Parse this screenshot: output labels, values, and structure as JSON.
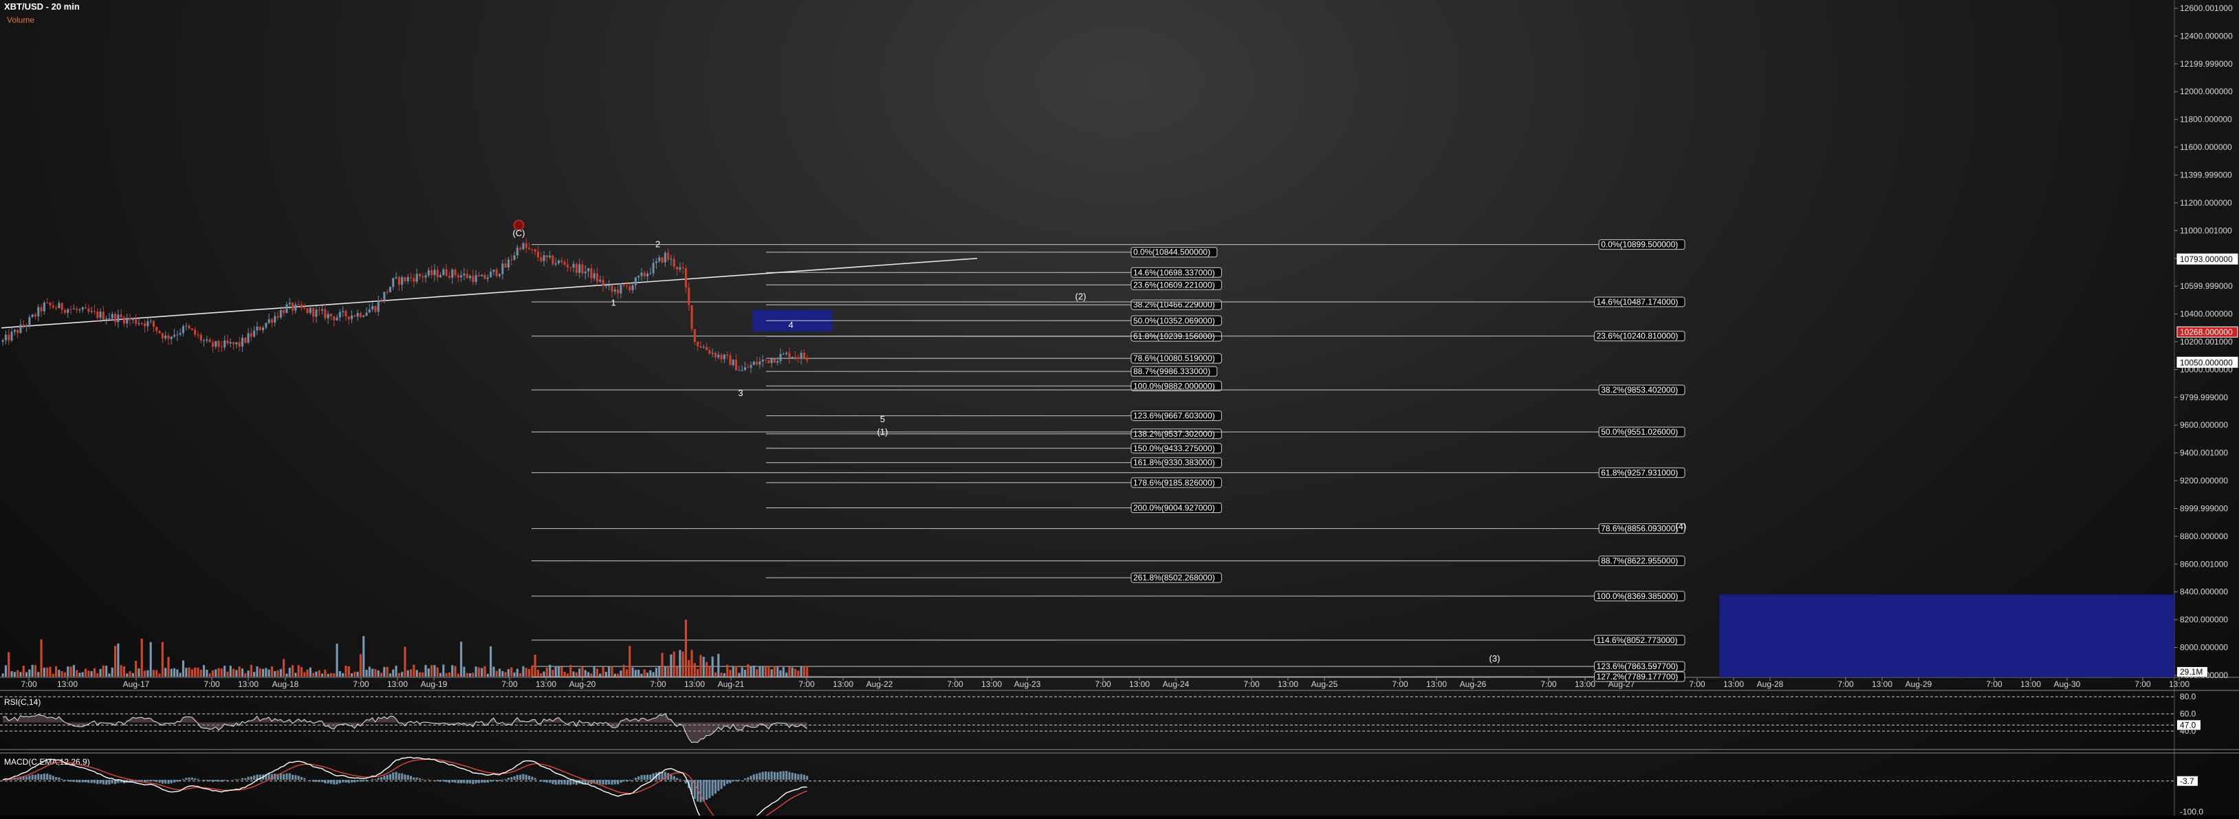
{
  "header": {
    "title": "XBT/USD - 20 min",
    "volume_label": "Volume"
  },
  "chart_data": [
    {
      "type": "line",
      "subtype": "candlestick",
      "title": "XBT/USD - 20 min",
      "price_axis": {
        "ticks": [
          "12600.001000",
          "12400.000000",
          "12199.999000",
          "12000.000000",
          "11800.000000",
          "11600.000000",
          "11399.999000",
          "11200.000000",
          "11000.001000",
          "10800.000000",
          "10599.999000",
          "10400.000000",
          "10200.001000",
          "10000.000000",
          "9799.999000",
          "9600.000000",
          "9400.001000",
          "9200.000000",
          "8999.999000",
          "8800.000000",
          "8600.001000",
          "8400.000000",
          "8200.000000",
          "8000.000000",
          "7800.000000"
        ],
        "tick_values": [
          12600,
          12400,
          12200,
          12000,
          11800,
          11600,
          11400,
          11200,
          11000,
          10800,
          10600,
          10400,
          10200,
          10000,
          9800,
          9600,
          9400,
          9200,
          9000,
          8800,
          8600,
          8400,
          8200,
          8000,
          7800
        ],
        "markers": [
          {
            "label": "10793.000000",
            "value": 10793,
            "color": "#ffffff"
          },
          {
            "label": "10268.000000",
            "value": 10268,
            "color": "#cc2222"
          },
          {
            "label": "10050.000000",
            "value": 10050,
            "color": "#ffffff"
          }
        ],
        "ylim": [
          7790,
          12600
        ]
      },
      "x_axis_ticks": [
        "7:00",
        "13:00",
        "Aug-17",
        "7:00",
        "13:00",
        "Aug-18",
        "7:00",
        "13:00",
        "Aug-19",
        "7:00",
        "13:00",
        "Aug-20",
        "7:00",
        "13:00",
        "Aug-21",
        "7:00",
        "13:00",
        "Aug-22",
        "7:00",
        "13:00",
        "Aug-23",
        "7:00",
        "13:00",
        "Aug-24",
        "7:00",
        "13:00",
        "Aug-25",
        "7:00",
        "13:00",
        "Aug-26",
        "7:00",
        "13:00",
        "Aug-27",
        "7:00",
        "13:00",
        "Aug-28",
        "7:00",
        "13:00",
        "Aug-29",
        "7:00",
        "13:00",
        "Aug-30",
        "7:00",
        "13:00"
      ],
      "price_path": [
        {
          "bar": 0,
          "price": 10200
        },
        {
          "bar": 8,
          "price": 10330
        },
        {
          "bar": 14,
          "price": 10460
        },
        {
          "bar": 22,
          "price": 10440
        },
        {
          "bar": 30,
          "price": 10400
        },
        {
          "bar": 40,
          "price": 10370
        },
        {
          "bar": 50,
          "price": 10330
        },
        {
          "bar": 55,
          "price": 10230
        },
        {
          "bar": 62,
          "price": 10300
        },
        {
          "bar": 70,
          "price": 10170
        },
        {
          "bar": 80,
          "price": 10180
        },
        {
          "bar": 88,
          "price": 10320
        },
        {
          "bar": 96,
          "price": 10450
        },
        {
          "bar": 104,
          "price": 10420
        },
        {
          "bar": 112,
          "price": 10380
        },
        {
          "bar": 120,
          "price": 10400
        },
        {
          "bar": 126,
          "price": 10450
        },
        {
          "bar": 132,
          "price": 10630
        },
        {
          "bar": 140,
          "price": 10670
        },
        {
          "bar": 150,
          "price": 10700
        },
        {
          "bar": 162,
          "price": 10650
        },
        {
          "bar": 170,
          "price": 10740
        },
        {
          "bar": 175,
          "price": 10899
        },
        {
          "bar": 182,
          "price": 10800
        },
        {
          "bar": 190,
          "price": 10760
        },
        {
          "bar": 198,
          "price": 10700
        },
        {
          "bar": 206,
          "price": 10560
        },
        {
          "bar": 212,
          "price": 10600
        },
        {
          "bar": 218,
          "price": 10700
        },
        {
          "bar": 224,
          "price": 10820
        },
        {
          "bar": 230,
          "price": 10700
        },
        {
          "bar": 234,
          "price": 10200
        },
        {
          "bar": 240,
          "price": 10120
        },
        {
          "bar": 246,
          "price": 10060
        },
        {
          "bar": 250,
          "price": 9990
        },
        {
          "bar": 254,
          "price": 10040
        },
        {
          "bar": 260,
          "price": 10080
        },
        {
          "bar": 266,
          "price": 10110
        },
        {
          "bar": 272,
          "price": 10090
        }
      ],
      "trendline": {
        "start": {
          "bar": 0,
          "price": 10300
        },
        "end": {
          "bar": 330,
          "price": 10800
        }
      },
      "wave_labels": [
        {
          "text": "(C)",
          "bar": 175,
          "price": 10960,
          "circled": true
        },
        {
          "text": "2",
          "bar": 222,
          "price": 10880
        },
        {
          "text": "1",
          "bar": 207,
          "price": 10460
        },
        {
          "text": "3",
          "bar": 250,
          "price": 9810
        },
        {
          "text": "4",
          "bar": 267,
          "price": 10300
        },
        {
          "text": "5",
          "bar": 298,
          "price": 9620
        },
        {
          "text": "(1)",
          "bar": 298,
          "price": 9530
        },
        {
          "text": "(2)",
          "bar": 365,
          "price": 10505
        },
        {
          "text": "(3)",
          "bar": 505,
          "price": 7900
        },
        {
          "text": "(4)",
          "bar": 568,
          "price": 8850
        }
      ],
      "target_boxes": [
        {
          "name": "wave-4-target",
          "bar_start": 254,
          "bar_end": 281,
          "price_top": 10430,
          "price_bottom": 10275
        },
        {
          "name": "wave-3-target",
          "bar_start": 581,
          "bar_end": 745,
          "price_top": 8380,
          "price_bottom": 7790
        }
      ],
      "fib_set_1": [
        {
          "label": "0.0%(10844.500000)",
          "value": 10844.5
        },
        {
          "label": "14.6%(10698.337000)",
          "value": 10698.337
        },
        {
          "label": "23.6%(10609.221000)",
          "value": 10609.221
        },
        {
          "label": "38.2%(10466.229000)",
          "value": 10466.229
        },
        {
          "label": "50.0%(10352.069000)",
          "value": 10352.069
        },
        {
          "label": "61.8%(10239.156000)",
          "value": 10239.156
        },
        {
          "label": "78.6%(10080.519000)",
          "value": 10080.519
        },
        {
          "label": "88.7%(9986.333000)",
          "value": 9986.333
        },
        {
          "label": "100.0%(9882.000000)",
          "value": 9882.0
        },
        {
          "label": "123.6%(9667.603000)",
          "value": 9667.603
        },
        {
          "label": "138.2%(9537.302000)",
          "value": 9537.302
        },
        {
          "label": "150.0%(9433.275000)",
          "value": 9433.275
        },
        {
          "label": "161.8%(9330.383000)",
          "value": 9330.383
        },
        {
          "label": "178.6%(9185.826000)",
          "value": 9185.826
        },
        {
          "label": "200.0%(9004.927000)",
          "value": 9004.927
        },
        {
          "label": "261.8%(8502.268000)",
          "value": 8502.268
        }
      ],
      "fib_set_2": [
        {
          "label": "0.0%(10899.500000)",
          "value": 10899.5
        },
        {
          "label": "14.6%(10487.174000)",
          "value": 10487.174
        },
        {
          "label": "23.6%(10240.810000)",
          "value": 10240.81
        },
        {
          "label": "38.2%(9853.402000)",
          "value": 9853.402
        },
        {
          "label": "50.0%(9551.026000)",
          "value": 9551.026
        },
        {
          "label": "61.8%(9257.931000)",
          "value": 9257.931
        },
        {
          "label": "78.6%(8856.093000)",
          "value": 8856.093
        },
        {
          "label": "88.7%(8622.955000)",
          "value": 8622.955
        },
        {
          "label": "100.0%(8369.385000)",
          "value": 8369.385
        },
        {
          "label": "114.6%(8052.773000)",
          "value": 8052.773
        },
        {
          "label": "123.6%(7863.597700)",
          "value": 7863.5977
        },
        {
          "label": "127.2%(7789.177700)",
          "value": 7789.1777
        }
      ],
      "volume_marker": "29.1M"
    },
    {
      "type": "line",
      "title": "RSI(C,14)",
      "ticks": [
        "80.0",
        "60.0",
        "47.0",
        "40.0"
      ],
      "tick_values": [
        80,
        60,
        47,
        40
      ],
      "current_value": "47.0",
      "ylim": [
        20,
        85
      ]
    },
    {
      "type": "line",
      "title": "MACD(C,EMA,12,26,9)",
      "ticks": [
        "-3.7",
        "-100.0"
      ],
      "tick_values": [
        -3.7,
        -100
      ],
      "current_value": "-3.7",
      "ylim": [
        -110,
        80
      ],
      "series": [
        {
          "name": "MACD",
          "color": "#ffffff"
        },
        {
          "name": "Signal",
          "color": "#e0483c"
        }
      ]
    }
  ],
  "colors": {
    "up_candle": "#6c8ea8",
    "down_candle": "#d03e2a",
    "volume": "#d0482a",
    "target_box": "#1a1f8c",
    "fib_line": "#c8c8c8",
    "grid_text": "#d8d8d8"
  }
}
